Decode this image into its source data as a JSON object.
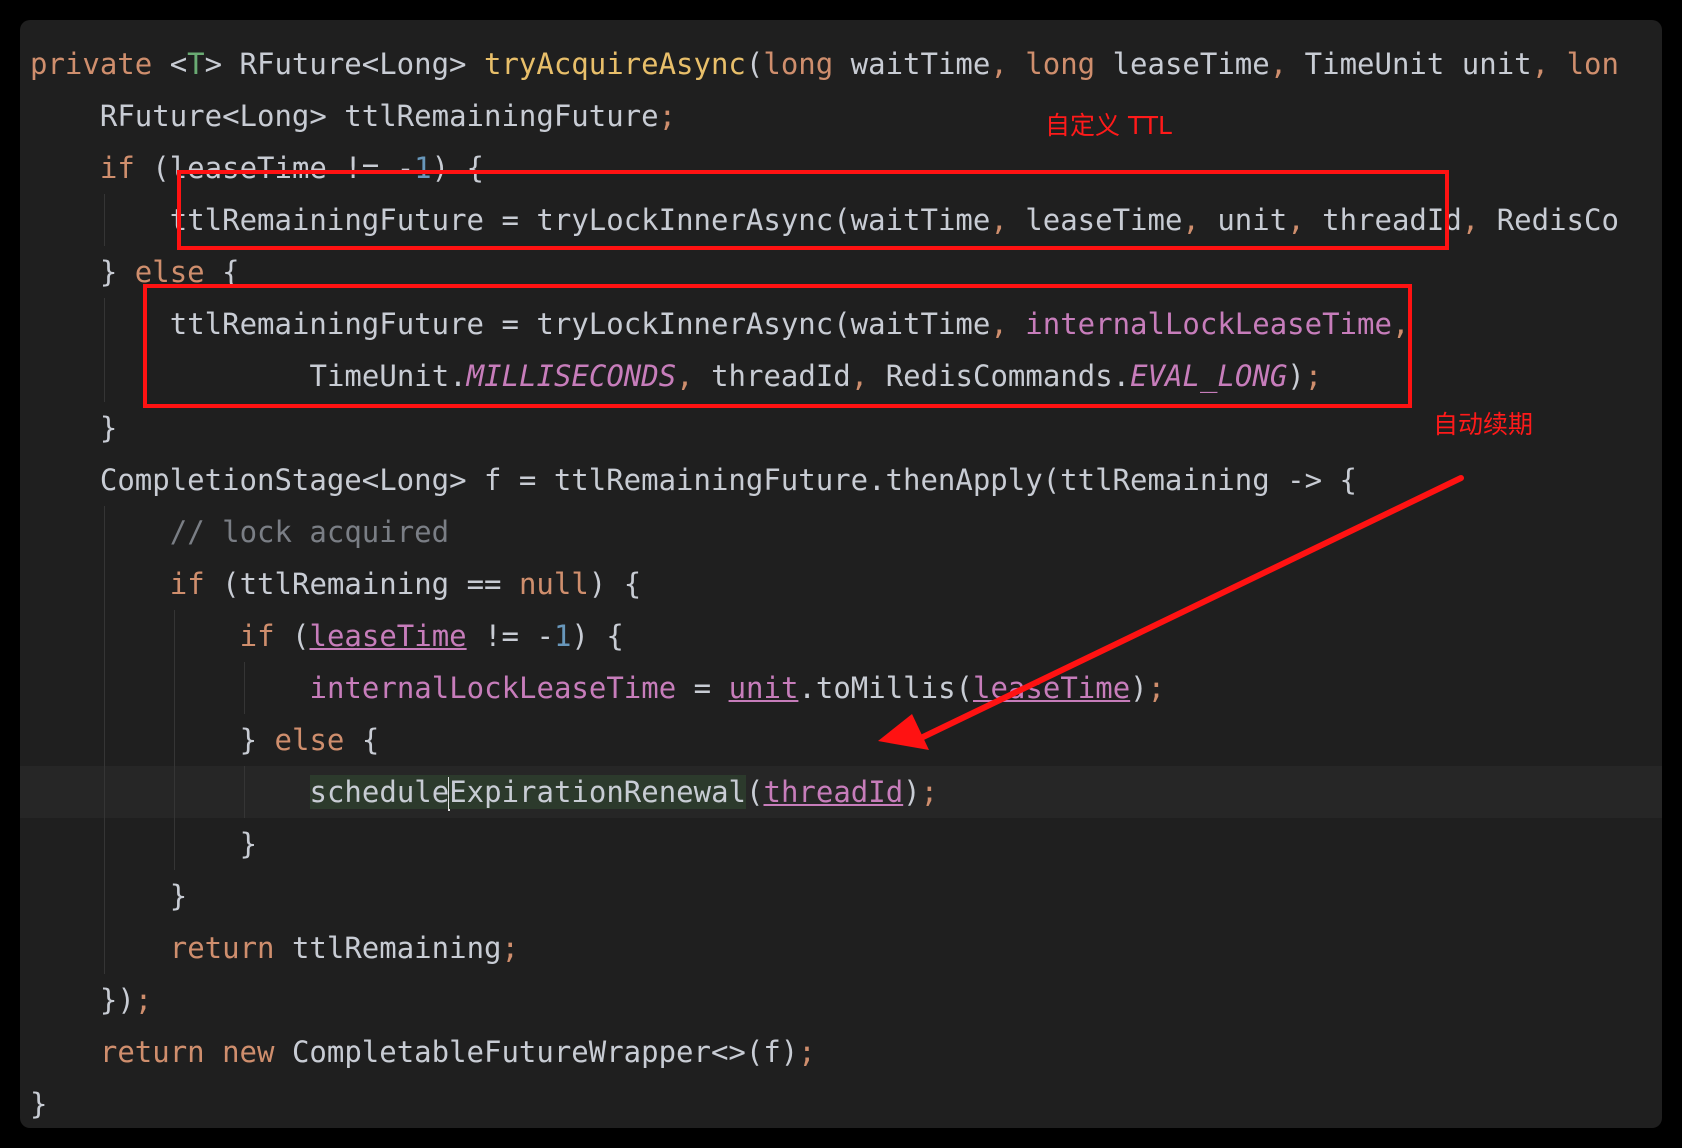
{
  "code_lines": [
    {
      "indent": 0,
      "guides": [],
      "tokens": [
        {
          "t": "private ",
          "c": "kw"
        },
        {
          "t": "<",
          "c": ""
        },
        {
          "t": "T",
          "c": "typ"
        },
        {
          "t": "> RFuture<Long> ",
          "c": ""
        },
        {
          "t": "tryAcquireAsync",
          "c": "fn"
        },
        {
          "t": "(",
          "c": ""
        },
        {
          "t": "long ",
          "c": "kw"
        },
        {
          "t": "waitTime",
          "c": ""
        },
        {
          "t": ", ",
          "c": "kw"
        },
        {
          "t": "long ",
          "c": "kw"
        },
        {
          "t": "leaseTime",
          "c": ""
        },
        {
          "t": ", ",
          "c": "kw"
        },
        {
          "t": "TimeUnit unit",
          "c": ""
        },
        {
          "t": ", ",
          "c": "kw"
        },
        {
          "t": "lon",
          "c": "kw"
        }
      ]
    },
    {
      "indent": 4,
      "guides": [],
      "tokens": [
        {
          "t": "RFuture<Long> ttlRemainingFuture",
          "c": ""
        },
        {
          "t": ";",
          "c": "kw"
        }
      ]
    },
    {
      "indent": 4,
      "guides": [],
      "tokens": [
        {
          "t": "if ",
          "c": "kw"
        },
        {
          "t": "(leaseTime != -",
          "c": ""
        },
        {
          "t": "1",
          "c": "num"
        },
        {
          "t": ") {",
          "c": ""
        }
      ]
    },
    {
      "indent": 8,
      "guides": [
        4
      ],
      "tokens": [
        {
          "t": "ttlRemainingFuture = tryLockInnerAsync(waitTime",
          "c": ""
        },
        {
          "t": ", ",
          "c": "kw"
        },
        {
          "t": "leaseTime",
          "c": ""
        },
        {
          "t": ", ",
          "c": "kw"
        },
        {
          "t": "unit",
          "c": ""
        },
        {
          "t": ", ",
          "c": "kw"
        },
        {
          "t": "threadId",
          "c": ""
        },
        {
          "t": ", ",
          "c": "kw"
        },
        {
          "t": "RedisCo",
          "c": ""
        }
      ]
    },
    {
      "indent": 4,
      "guides": [],
      "tokens": [
        {
          "t": "} ",
          "c": ""
        },
        {
          "t": "else ",
          "c": "kw"
        },
        {
          "t": "{",
          "c": ""
        }
      ]
    },
    {
      "indent": 8,
      "guides": [
        4
      ],
      "tokens": [
        {
          "t": "ttlRemainingFuture = tryLockInnerAsync(waitTime",
          "c": ""
        },
        {
          "t": ", ",
          "c": "kw"
        },
        {
          "t": "internalLockLeaseTime",
          "c": "fld"
        },
        {
          "t": ",",
          "c": "kw"
        }
      ]
    },
    {
      "indent": 16,
      "guides": [
        4
      ],
      "tokens": [
        {
          "t": "TimeUnit.",
          "c": ""
        },
        {
          "t": "MILLISECONDS",
          "c": "fld ital"
        },
        {
          "t": ", ",
          "c": "kw"
        },
        {
          "t": "threadId",
          "c": ""
        },
        {
          "t": ", ",
          "c": "kw"
        },
        {
          "t": "RedisCommands.",
          "c": ""
        },
        {
          "t": "EVAL_LONG",
          "c": "fld ital"
        },
        {
          "t": ")",
          "c": ""
        },
        {
          "t": ";",
          "c": "kw"
        }
      ]
    },
    {
      "indent": 4,
      "guides": [],
      "tokens": [
        {
          "t": "}",
          "c": ""
        }
      ]
    },
    {
      "indent": 4,
      "guides": [],
      "tokens": [
        {
          "t": "CompletionStage<Long> f = ttlRemainingFuture.thenApply(ttlRemaining -> {",
          "c": ""
        }
      ]
    },
    {
      "indent": 8,
      "guides": [
        4
      ],
      "tokens": [
        {
          "t": "// lock acquired",
          "c": "cmt"
        }
      ]
    },
    {
      "indent": 8,
      "guides": [
        4
      ],
      "tokens": [
        {
          "t": "if ",
          "c": "kw"
        },
        {
          "t": "(ttlRemaining == ",
          "c": ""
        },
        {
          "t": "null",
          "c": "kw"
        },
        {
          "t": ") {",
          "c": ""
        }
      ]
    },
    {
      "indent": 12,
      "guides": [
        4,
        8
      ],
      "tokens": [
        {
          "t": "if ",
          "c": "kw"
        },
        {
          "t": "(",
          "c": ""
        },
        {
          "t": "leaseTime",
          "c": "fld ul"
        },
        {
          "t": " != -",
          "c": ""
        },
        {
          "t": "1",
          "c": "num"
        },
        {
          "t": ") {",
          "c": ""
        }
      ]
    },
    {
      "indent": 16,
      "guides": [
        4,
        8,
        12
      ],
      "tokens": [
        {
          "t": "internalLockLeaseTime",
          "c": "fld"
        },
        {
          "t": " = ",
          "c": ""
        },
        {
          "t": "unit",
          "c": "fld ul"
        },
        {
          "t": ".toMillis(",
          "c": ""
        },
        {
          "t": "leaseTime",
          "c": "fld ul"
        },
        {
          "t": ")",
          "c": ""
        },
        {
          "t": ";",
          "c": "kw"
        }
      ]
    },
    {
      "indent": 12,
      "guides": [
        4,
        8
      ],
      "tokens": [
        {
          "t": "} ",
          "c": ""
        },
        {
          "t": "else ",
          "c": "kw"
        },
        {
          "t": "{",
          "c": ""
        }
      ]
    },
    {
      "indent": 16,
      "guides": [
        4,
        8,
        12
      ],
      "current": true,
      "tokens": [
        {
          "t": "schedule",
          "c": "hl"
        },
        {
          "caret": true
        },
        {
          "t": "ExpirationRenewal",
          "c": "hl"
        },
        {
          "t": "(",
          "c": ""
        },
        {
          "t": "threadId",
          "c": "fld ul"
        },
        {
          "t": ")",
          "c": ""
        },
        {
          "t": ";",
          "c": "kw"
        }
      ]
    },
    {
      "indent": 12,
      "guides": [
        4,
        8
      ],
      "tokens": [
        {
          "t": "}",
          "c": ""
        }
      ]
    },
    {
      "indent": 8,
      "guides": [
        4
      ],
      "tokens": [
        {
          "t": "}",
          "c": ""
        }
      ]
    },
    {
      "indent": 8,
      "guides": [
        4
      ],
      "tokens": [
        {
          "t": "return ",
          "c": "kw"
        },
        {
          "t": "ttlRemaining",
          "c": ""
        },
        {
          "t": ";",
          "c": "kw"
        }
      ]
    },
    {
      "indent": 4,
      "guides": [],
      "tokens": [
        {
          "t": "})",
          "c": ""
        },
        {
          "t": ";",
          "c": "kw"
        }
      ]
    },
    {
      "indent": 4,
      "guides": [],
      "tokens": [
        {
          "t": "return ",
          "c": "kw"
        },
        {
          "t": "new ",
          "c": "kw"
        },
        {
          "t": "CompletableFutureWrapper<>(f)",
          "c": ""
        },
        {
          "t": ";",
          "c": "kw"
        }
      ]
    },
    {
      "indent": 0,
      "guides": [],
      "tokens": [
        {
          "t": "}",
          "c": ""
        }
      ]
    }
  ],
  "annotations": {
    "custom_ttl": "自定义 TTL",
    "auto_renewal": "自动续期"
  },
  "colors": {
    "background": "#1f1f1f",
    "default_text": "#c8ccd4",
    "keyword": "#cf8e6d",
    "function": "#e8bf6a",
    "field": "#c77dbb",
    "number": "#6897bb",
    "comment": "#7a7e85",
    "annotation_red": "#ff1212"
  }
}
